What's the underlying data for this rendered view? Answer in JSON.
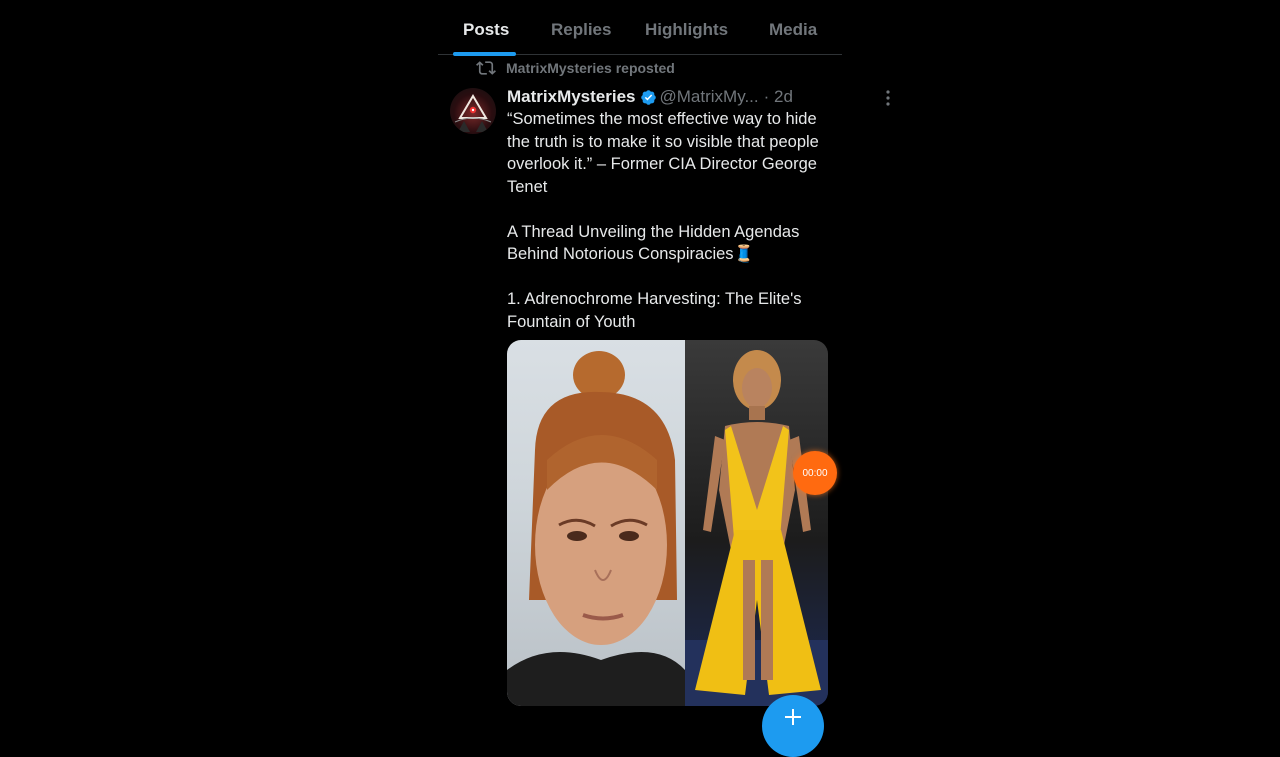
{
  "tabs": [
    {
      "label": "Posts",
      "active": true
    },
    {
      "label": "Replies",
      "active": false
    },
    {
      "label": "Highlights",
      "active": false
    },
    {
      "label": "Media",
      "active": false
    }
  ],
  "repost": {
    "text": "MatrixMysteries reposted",
    "icon": "repost-icon"
  },
  "tweet": {
    "author_name": "MatrixMysteries",
    "verified": true,
    "handle": "@MatrixMy...",
    "time": "· 2d",
    "paragraphs": [
      "“Sometimes the most effective way to hide the truth is to make it so visible that people overlook it.” – Former CIA Director George Tenet",
      "A Thread Unveiling the Hidden Agendas Behind Notorious Conspiracies🧵",
      "1. Adrenochrome Harvesting: The Elite's Fountain of Youth"
    ],
    "media_count": 2
  },
  "overlay": {
    "timer": "00:00"
  },
  "colors": {
    "accent": "#1d9bf0",
    "background": "#000000",
    "text": "#e7e9ea",
    "muted": "#71767b",
    "timer": "#ff6a10"
  }
}
